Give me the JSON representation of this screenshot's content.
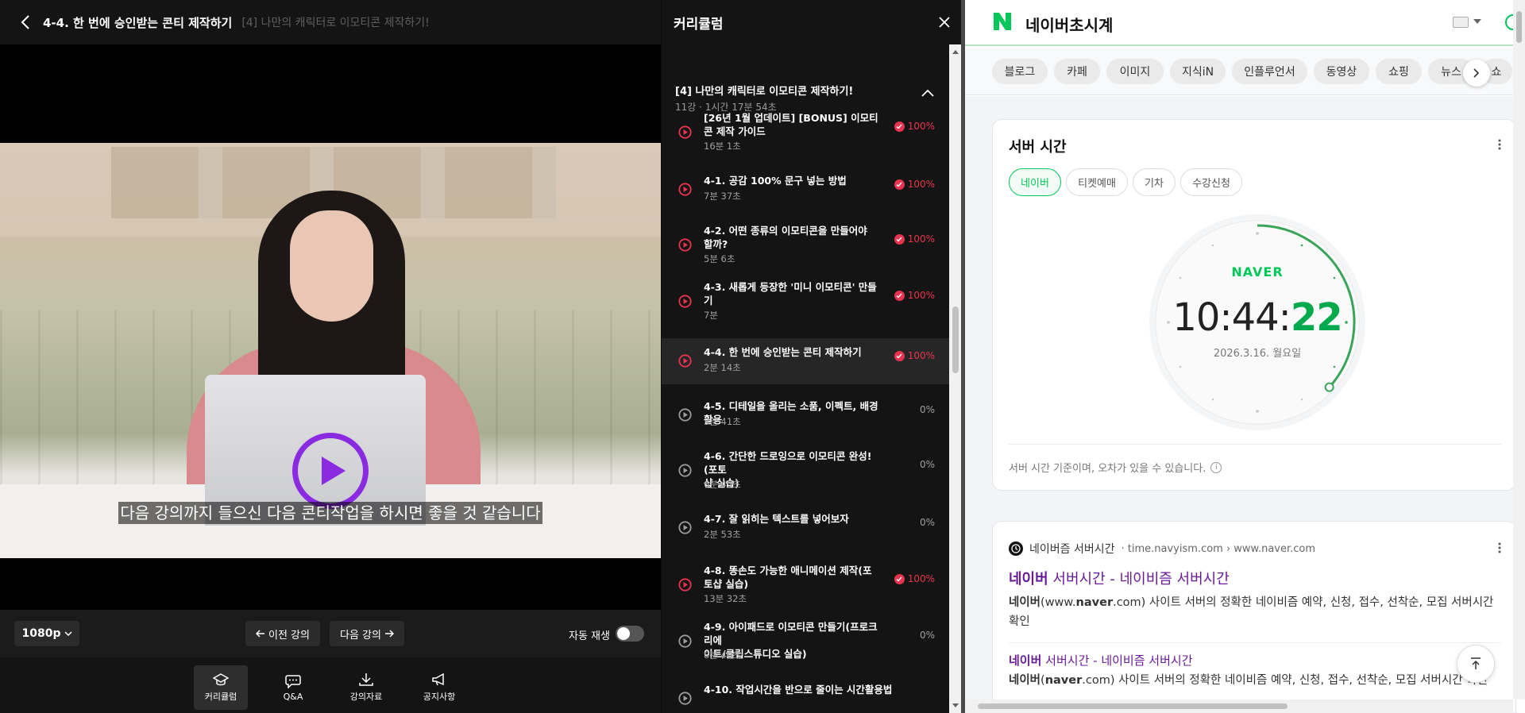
{
  "video": {
    "header": {
      "lecture_title": "4-4. 한 번에 승인받는 콘티 제작하기",
      "course_title": "[4] 나만의 캐릭터로 이모티콘 제작하기!"
    },
    "subtitle": "다음 강의까지 들으신 다음 콘티작업을 하시면 좋을 것 같습니다",
    "controls": {
      "quality": "1080p",
      "prev": "이전 강의",
      "next": "다음 강의",
      "autoplay_label": "자동 재생",
      "autoplay_on": false
    },
    "nav": [
      {
        "label": "커리큘럼",
        "icon": "graduation-cap-icon",
        "active": true
      },
      {
        "label": "Q&A",
        "icon": "chat-bubble-icon",
        "active": false
      },
      {
        "label": "강의자료",
        "icon": "download-icon",
        "active": false
      },
      {
        "label": "공지사항",
        "icon": "megaphone-icon",
        "active": false
      }
    ]
  },
  "curriculum": {
    "title": "커리큘럼",
    "section": {
      "name": "[4] 나만의 캐릭터로 이모티콘 제작하기!",
      "meta": "11강 · 1시간 17분 54초"
    },
    "lessons": [
      {
        "line1": "[26년 1월 업데이트] [BONUS] 이모티",
        "line2": "콘 제작 가이드",
        "duration": "16분 1초",
        "progress": "100%",
        "done": true
      },
      {
        "line1": "4-1. 공감 100% 문구 넣는 방법",
        "line2": "",
        "duration": "7분 37초",
        "progress": "100%",
        "done": true
      },
      {
        "line1": "4-2. 어떤 종류의 이모티콘을 만들어야",
        "line2": "할까?",
        "duration": "5분 6초",
        "progress": "100%",
        "done": true
      },
      {
        "line1": "4-3. 새롭게 등장한 '미니 이모티콘' 만들",
        "line2": "기",
        "duration": "7분",
        "progress": "100%",
        "done": true
      },
      {
        "line1": "4-4. 한 번에 승인받는 콘티 제작하기",
        "line2": "",
        "duration": "2분 14초",
        "progress": "100%",
        "done": true,
        "current": true
      },
      {
        "line1": "4-5. 디테일을 올리는 소품, 이펙트, 배경 활용",
        "line2": "",
        "duration": "3분 41초",
        "progress": "0%",
        "done": false
      },
      {
        "line1": "4-6. 간단한 드로잉으로 이모티콘 완성!(포토",
        "line2": "샵 실습)",
        "duration": "6분 45초",
        "progress": "0%",
        "done": false
      },
      {
        "line1": "4-7. 잘 읽히는 텍스트를 넣어보자",
        "line2": "",
        "duration": "2분 53초",
        "progress": "0%",
        "done": false
      },
      {
        "line1": "4-8. 똥손도 가능한 애니메이션 제작(포",
        "line2": "토샵 실습)",
        "duration": "13분 32초",
        "progress": "100%",
        "done": true
      },
      {
        "line1": "4-9. 아이패드로 이모티콘 만들기(프로크리에",
        "line2": "이트/클립스튜디오 실습)",
        "duration": "8분 46초",
        "progress": "0%",
        "done": false
      },
      {
        "line1": "4-10. 작업시간을 반으로 줄이는 시간활용법",
        "line2": "",
        "duration": "",
        "progress": "",
        "done": false
      }
    ]
  },
  "browser": {
    "query": "네이버초시계",
    "tabs": [
      "블로그",
      "카페",
      "이미지",
      "지식iN",
      "인플루언서",
      "동영상",
      "쇼핑",
      "뉴스",
      "쇼"
    ],
    "server_time": {
      "title": "서버 시간",
      "chips": [
        "네이버",
        "티켓예매",
        "기차",
        "수강신청"
      ],
      "active_chip": 0,
      "brand": "NAVER",
      "time_hm": "10:44:",
      "time_s": "22",
      "seconds_value": 22,
      "date": "2026.3.16. 월요일",
      "note": "서버 시간 기준이며, 오차가 있을 수 있습니다."
    },
    "result": {
      "site": "네이버즘 서버시간",
      "url": "· time.navyism.com › www.naver.com",
      "title_bold": "네이버",
      "title_rest": " 서버시간 - 네이비즘 서버시간",
      "desc_bold1": "네이버",
      "desc_p1": "(www.",
      "desc_bold2": "naver",
      "desc_p2": ".com) 사이트 서버의 정확한 네이비즘 예약, 신청, 접수, 선착순, 모집 서버시간 확인",
      "sub_title_bold": "네이버",
      "sub_title_rest": " 서버시간 - 네이비즘 서버시간",
      "sub_desc_bold1": "네이버",
      "sub_desc_p1": "(",
      "sub_desc_bold2": "naver",
      "sub_desc_p2": ".com) 사이트 서버의 정확한 네이비즘 예약, 신청, 접수, 선착순, 모집 서버시간 확인"
    }
  },
  "colors": {
    "accent_purple": "#8a2be2",
    "done_red": "#e8344e",
    "naver_green": "#03c75a"
  }
}
